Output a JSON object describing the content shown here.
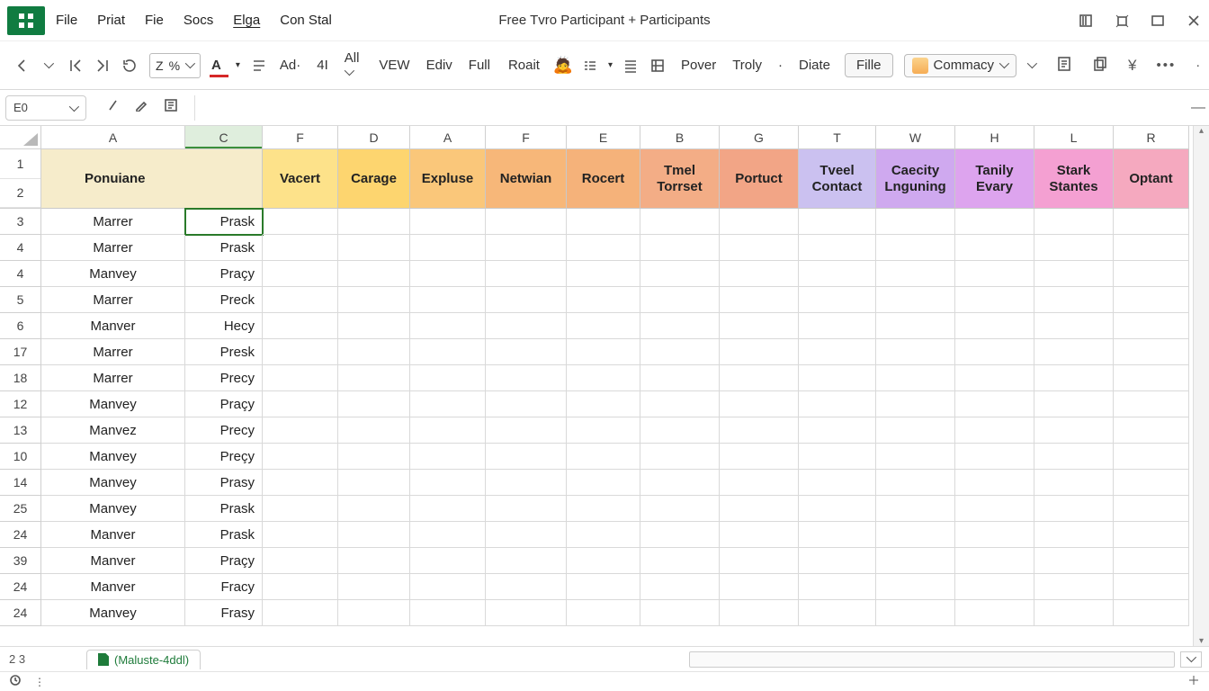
{
  "title": "Free Tvro Participant + Participants",
  "menubar": [
    "File",
    "Priat",
    "Fie",
    "Socs",
    "Elga",
    "Con Stal"
  ],
  "underlined_menu_index": 4,
  "ribbon": {
    "dd_items": [
      "Z",
      "%"
    ],
    "font_letter": "A",
    "midA": [
      "Ad·",
      "4I",
      "All"
    ],
    "midB": [
      "VEW",
      "Ediv",
      "Full"
    ],
    "roait": "Roait",
    "right_words": [
      "Pover",
      "Troly",
      "·",
      "Diate"
    ],
    "fille": "Fille",
    "commacy": "Commacy"
  },
  "namebox": "E0",
  "columns": [
    "A",
    "C",
    "F",
    "D",
    "A",
    "F",
    "E",
    "B",
    "G",
    "T",
    "W",
    "H",
    "L",
    "R"
  ],
  "selected_col_index": 1,
  "header_ponuiane": "Ponuiane",
  "headers": [
    {
      "label": "Vacert",
      "cls": "c-yel1"
    },
    {
      "label": "Carage",
      "cls": "c-yel2"
    },
    {
      "label": "Expluse",
      "cls": "c-orn1"
    },
    {
      "label": "Netwian",
      "cls": "c-orn2"
    },
    {
      "label": "Rocert",
      "cls": "c-orn3"
    },
    {
      "label": "Tmel\nTorrset",
      "cls": "c-peach"
    },
    {
      "label": "Portuct",
      "cls": "c-peach2"
    },
    {
      "label": "Tveel\nContact",
      "cls": "c-lav"
    },
    {
      "label": "Caecity\nLnguning",
      "cls": "c-pur"
    },
    {
      "label": "Tanily\nEvary",
      "cls": "c-pur2"
    },
    {
      "label": "Stark\nStantes",
      "cls": "c-pink"
    },
    {
      "label": "Optant",
      "cls": "c-pink2"
    }
  ],
  "rows": [
    {
      "n": "3",
      "a": "Marrer",
      "c": "Prask"
    },
    {
      "n": "4",
      "a": "Marrer",
      "c": "Prask"
    },
    {
      "n": "4",
      "a": "Manvey",
      "c": "Praçy"
    },
    {
      "n": "5",
      "a": "Marrer",
      "c": "Preck"
    },
    {
      "n": "6",
      "a": "Manver",
      "c": "Hecy"
    },
    {
      "n": "17",
      "a": "Marrer",
      "c": "Presk"
    },
    {
      "n": "18",
      "a": "Marrer",
      "c": "Precy"
    },
    {
      "n": "12",
      "a": "Manvey",
      "c": "Praçy"
    },
    {
      "n": "13",
      "a": "Manvez",
      "c": "Precy"
    },
    {
      "n": "10",
      "a": "Manvey",
      "c": "Preçy"
    },
    {
      "n": "14",
      "a": "Manvey",
      "c": "Prasy"
    },
    {
      "n": "25",
      "a": "Manvey",
      "c": "Prask"
    },
    {
      "n": "24",
      "a": "Manver",
      "c": "Prask"
    },
    {
      "n": "39",
      "a": "Manver",
      "c": "Praçy"
    },
    {
      "n": "24",
      "a": "Manver",
      "c": "Fracy"
    },
    {
      "n": "24",
      "a": "Manvey",
      "c": "Frasy"
    }
  ],
  "sheet_left": "2  3",
  "sheet_tab": "(Maluste-4ddl)",
  "chart_data": {
    "type": "table",
    "note": "spreadsheet screenshot; tabular data captured in rows[]"
  }
}
